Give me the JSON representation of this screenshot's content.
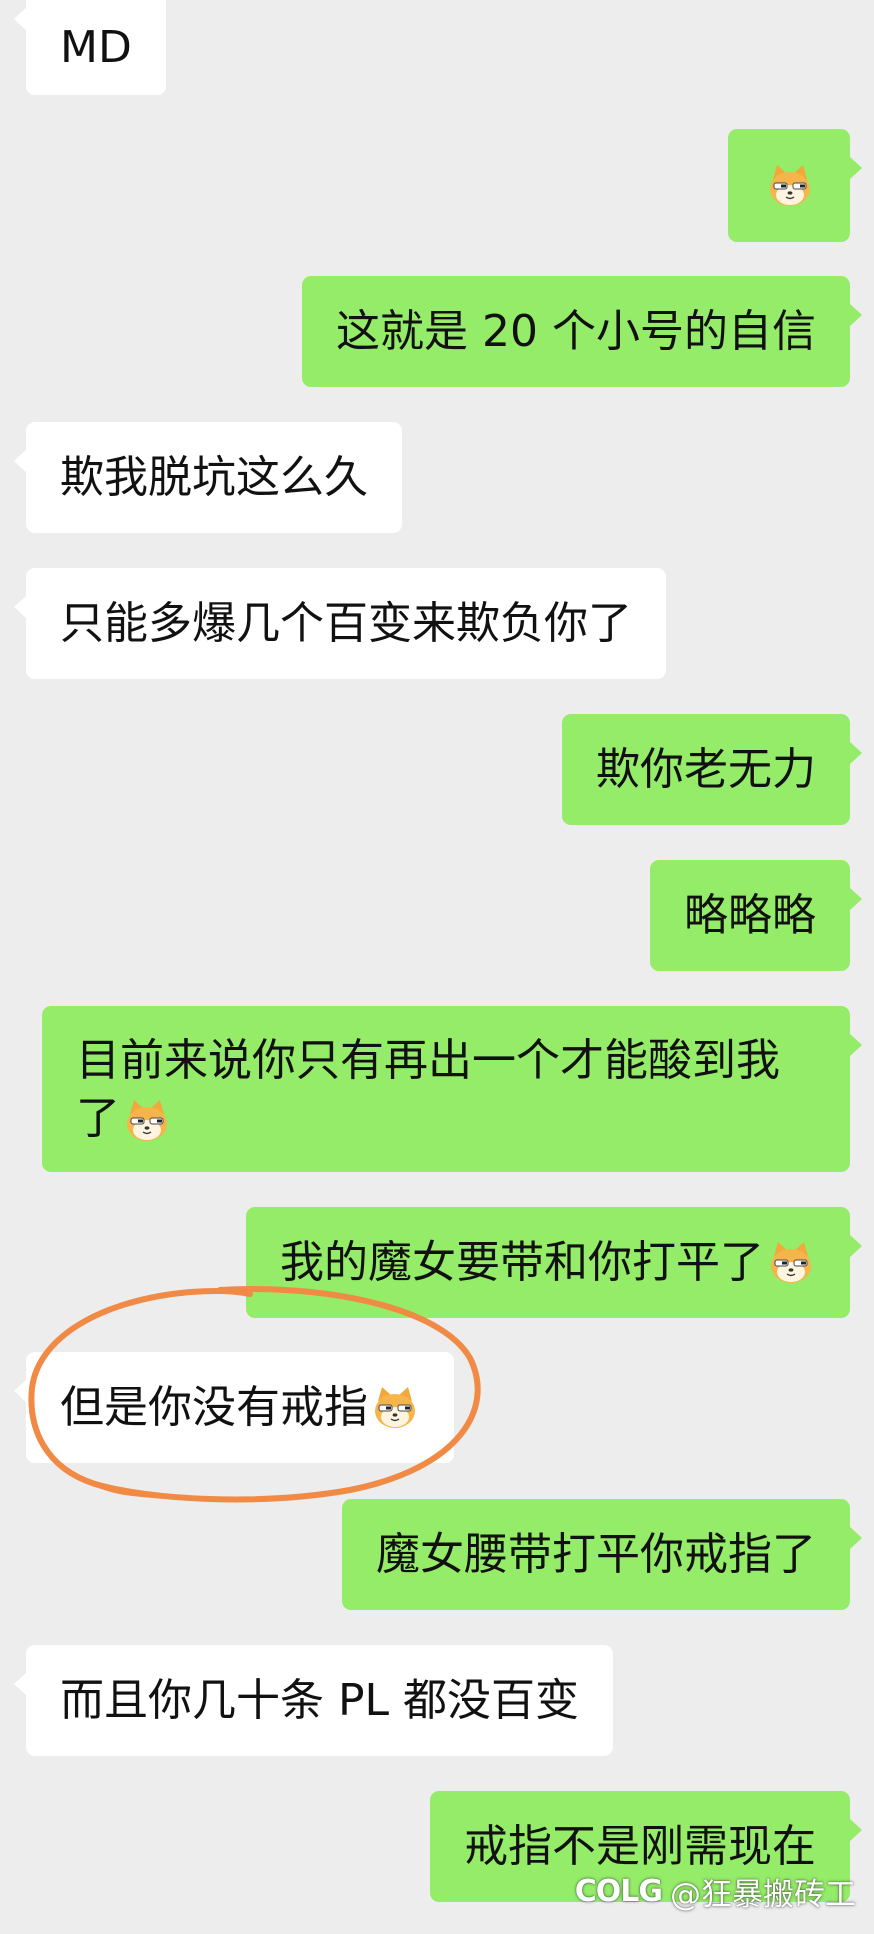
{
  "messages": [
    {
      "side": "in",
      "text": "MD"
    },
    {
      "side": "out",
      "text": "",
      "emoji": "doge-emoji"
    },
    {
      "side": "out",
      "text": "这就是 20 个小号的自信"
    },
    {
      "side": "in",
      "text": "欺我脱坑这么久"
    },
    {
      "side": "in",
      "text": "只能多爆几个百变来欺负你了"
    },
    {
      "side": "out",
      "text": "欺你老无力"
    },
    {
      "side": "out",
      "text": "略略略"
    },
    {
      "side": "out",
      "text": "目前来说你只有再出一个才能酸到我了",
      "emoji": "doge-emoji"
    },
    {
      "side": "out",
      "text": "我的魔女要带和你打平了",
      "emoji": "doge-emoji"
    },
    {
      "side": "in",
      "text": "但是你没有戒指",
      "emoji": "doge-emoji",
      "annotated": true
    },
    {
      "side": "out",
      "text": "魔女腰带打平你戒指了"
    },
    {
      "side": "in",
      "text": "而且你几十条 PL 都没百变"
    },
    {
      "side": "out",
      "text": "戒指不是刚需现在"
    }
  ],
  "watermark": {
    "logo": "COLG",
    "text": "@狂暴搬砖工"
  },
  "colors": {
    "background": "#ededed",
    "incoming_bubble": "#ffffff",
    "outgoing_bubble": "#95ec69",
    "annotation": "#f08a45"
  }
}
